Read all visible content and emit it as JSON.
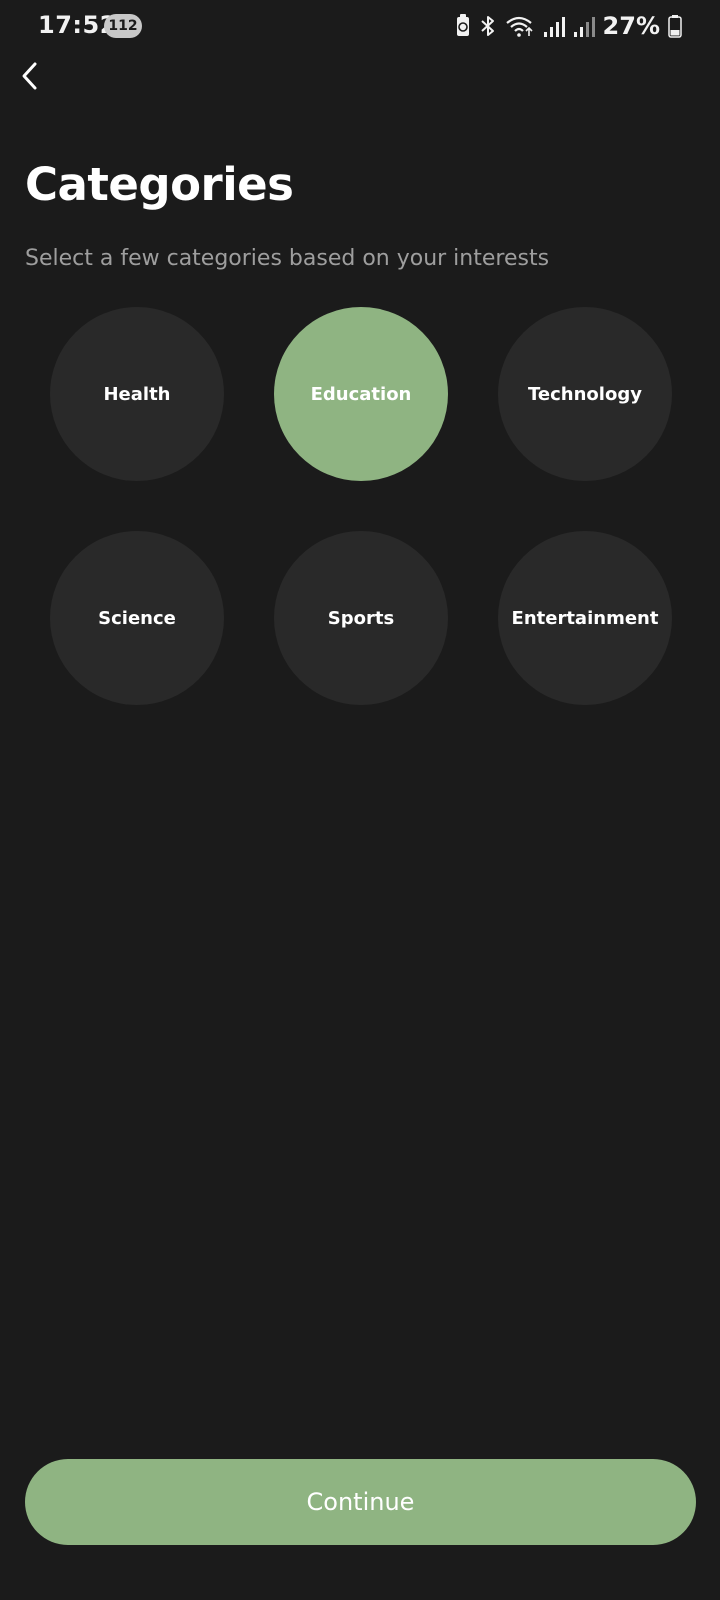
{
  "status_bar": {
    "time": "17:52",
    "notification_count": "112",
    "battery_percent": "27%",
    "icons": [
      "battery-saver-icon",
      "bluetooth-icon",
      "wifi-icon",
      "signal-icon",
      "signal-icon",
      "battery-icon"
    ]
  },
  "header": {
    "title": "Categories",
    "subtitle": "Select a few categories based on your interests"
  },
  "categories": [
    {
      "label": "Health",
      "selected": false
    },
    {
      "label": "Education",
      "selected": true
    },
    {
      "label": "Technology",
      "selected": false
    },
    {
      "label": "Science",
      "selected": false
    },
    {
      "label": "Sports",
      "selected": false
    },
    {
      "label": "Entertainment",
      "selected": false
    }
  ],
  "footer": {
    "continue_label": "Continue"
  },
  "colors": {
    "background": "#1b1b1b",
    "tile": "#292929",
    "accent": "#8fb482",
    "subtitle": "#9e9e9e"
  }
}
